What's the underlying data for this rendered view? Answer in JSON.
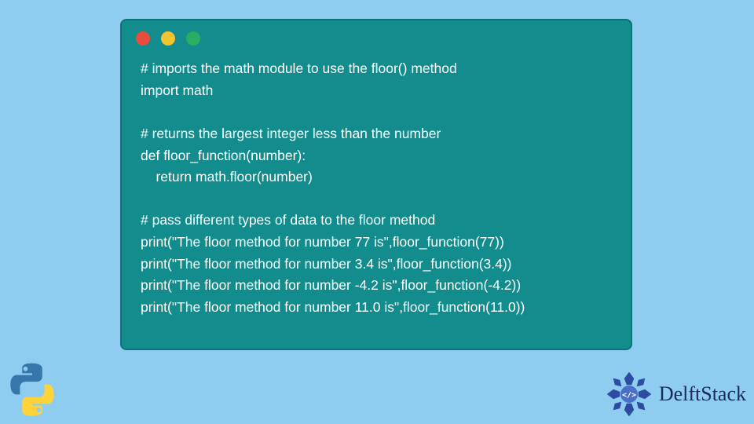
{
  "code": {
    "lines": [
      "# imports the math module to use the floor() method",
      "import math",
      "",
      "# returns the largest integer less than the number",
      "def floor_function(number):",
      "    return math.floor(number)",
      "",
      "# pass different types of data to the floor method",
      "print(\"The floor method for number 77 is\",floor_function(77))",
      "print(\"The floor method for number 3.4 is\",floor_function(3.4))",
      "print(\"The floor method for number -4.2 is\",floor_function(-4.2))",
      "print(\"The floor method for number 11.0 is\",floor_function(11.0))"
    ]
  },
  "brand": {
    "name": "DelftStack"
  },
  "colors": {
    "background": "#8fcdf0",
    "code_bg": "#128c8c",
    "text": "#ffffff",
    "brand": "#1a2a5e"
  }
}
